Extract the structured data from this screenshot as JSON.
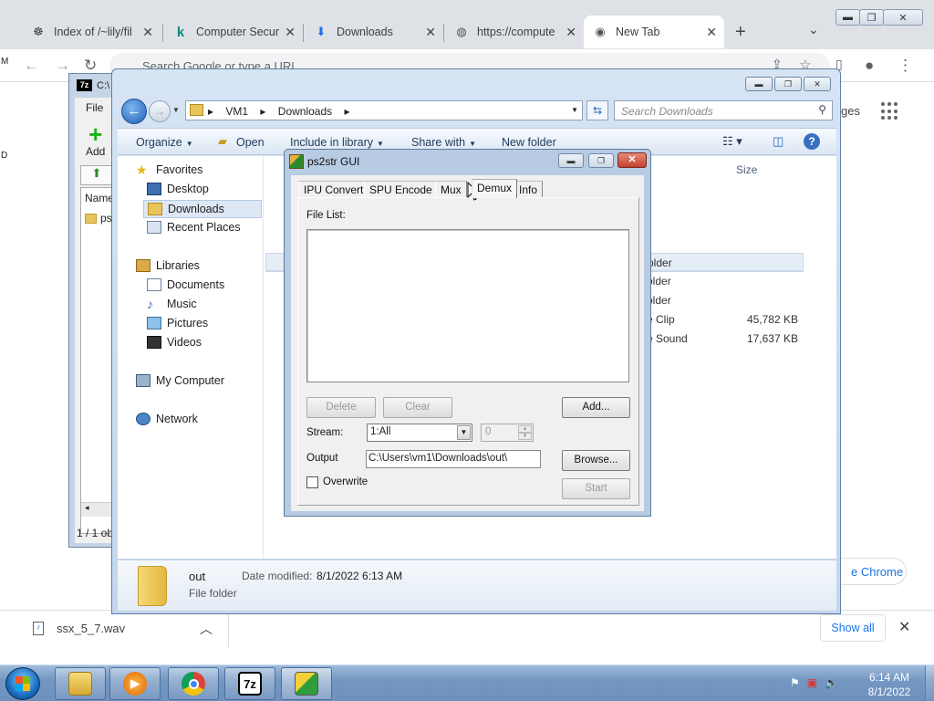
{
  "chrome": {
    "tabs": [
      {
        "title": "Index of /~lily/fil",
        "icon": "lily-favicon"
      },
      {
        "title": "Computer Secur",
        "icon": "k-favicon"
      },
      {
        "title": "Downloads",
        "icon": "download-icon"
      },
      {
        "title": "https://compute",
        "icon": "globe-icon"
      },
      {
        "title": "New Tab",
        "icon": "chrome-icon"
      }
    ],
    "omnibox_placeholder": "Search Google or type a URL",
    "right_peek_text": "ges",
    "pill_text": "e Chrome",
    "download": {
      "filename": "ssx_5_7.wav"
    },
    "show_all_label": "Show all"
  },
  "desktop_edge": {
    "top": "M",
    "mid": "D"
  },
  "zip": {
    "title": "C:\\",
    "menu_file": "File",
    "add_label": "Add",
    "col_name": "Name",
    "row_name": "ps2",
    "status": "1 / 1 ob"
  },
  "explorer": {
    "breadcrumbs": [
      "VM1",
      "Downloads"
    ],
    "search_placeholder": "Search Downloads",
    "commands": {
      "organize": "Organize",
      "open": "Open",
      "include": "Include in library",
      "share": "Share with",
      "newfolder": "New folder"
    },
    "nav": {
      "favorites": "Favorites",
      "desktop": "Desktop",
      "downloads": "Downloads",
      "recent": "Recent Places",
      "libraries": "Libraries",
      "documents": "Documents",
      "music": "Music",
      "pictures": "Pictures",
      "videos": "Videos",
      "computer": "My Computer",
      "network": "Network"
    },
    "col_size": "Size",
    "files": [
      {
        "name": "older",
        "size": ""
      },
      {
        "name": "older",
        "size": ""
      },
      {
        "name": "older",
        "size": ""
      },
      {
        "name": "e Clip",
        "size": "45,782 KB"
      },
      {
        "name": "e Sound",
        "size": "17,637 KB"
      }
    ],
    "details": {
      "name": "out",
      "type": "File folder",
      "modified_label": "Date modified:",
      "modified_value": "8/1/2022 6:13 AM"
    }
  },
  "ps2str": {
    "title": "ps2str GUI",
    "tabs": [
      "IPU Convert",
      "SPU Encode",
      "Mux",
      "Demux",
      "Info"
    ],
    "active_tab": "Demux",
    "file_list_label": "File List:",
    "delete_label": "Delete",
    "clear_label": "Clear",
    "add_label": "Add...",
    "stream_label": "Stream:",
    "stream_value": "1:All",
    "stream_index": "0",
    "output_label": "Output",
    "output_value": "C:\\Users\\vm1\\Downloads\\out\\",
    "browse_label": "Browse...",
    "overwrite_label": "Overwrite",
    "overwrite_checked": false,
    "start_label": "Start"
  },
  "taskbar": {
    "apps": [
      "explorer",
      "media-player",
      "chrome",
      "7zip",
      "ps2str"
    ],
    "zip_text": "7z",
    "time": "6:14 AM",
    "date": "8/1/2022"
  }
}
